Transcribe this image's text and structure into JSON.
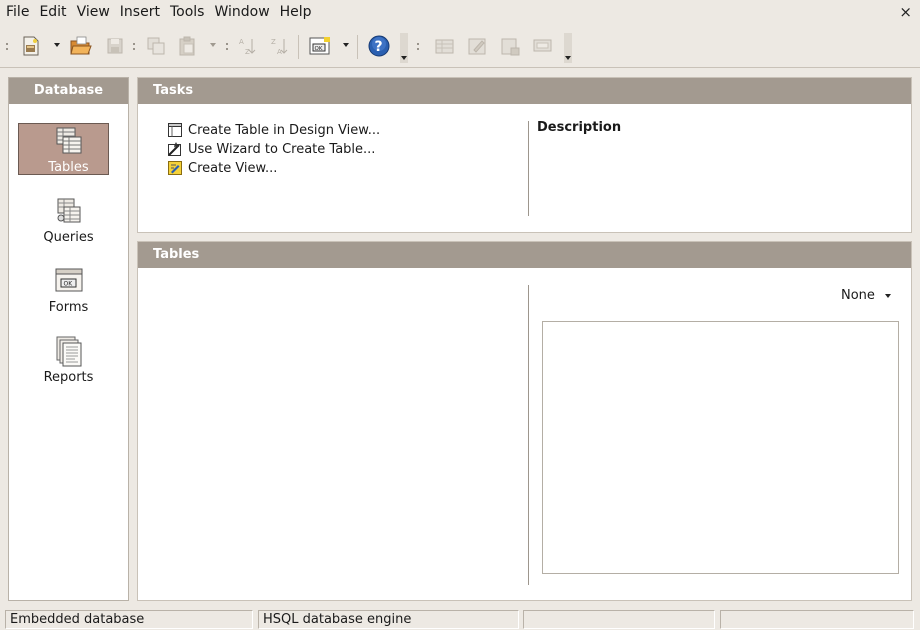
{
  "menubar": {
    "items": [
      "File",
      "Edit",
      "View",
      "Insert",
      "Tools",
      "Window",
      "Help"
    ],
    "close_glyph": "×"
  },
  "toolbar": {
    "icons": [
      "new-icon",
      "open-icon",
      "save-icon",
      "copy-icon",
      "paste-icon",
      "sort-ascending-icon",
      "sort-descending-icon",
      "form-design-icon",
      "help-icon",
      "table-icon",
      "edit-icon",
      "delete-icon",
      "rename-icon"
    ]
  },
  "sidebar": {
    "title": "Database",
    "items": [
      {
        "label": "Tables",
        "icon": "tables-icon",
        "selected": true
      },
      {
        "label": "Queries",
        "icon": "queries-icon",
        "selected": false
      },
      {
        "label": "Forms",
        "icon": "forms-icon",
        "selected": false
      },
      {
        "label": "Reports",
        "icon": "reports-icon",
        "selected": false
      }
    ]
  },
  "tasks": {
    "title": "Tasks",
    "items": [
      {
        "label": "Create Table in Design View...",
        "icon": "table-design-icon"
      },
      {
        "label": "Use Wizard to Create Table...",
        "icon": "wizard-icon"
      },
      {
        "label": "Create View...",
        "icon": "create-view-icon"
      }
    ],
    "description_title": "Description"
  },
  "tables": {
    "title": "Tables",
    "preview_option": "None"
  },
  "statusbar": {
    "cells": [
      "Embedded database",
      "HSQL database engine",
      "",
      ""
    ]
  },
  "colors": {
    "header_bg": "#a39a90",
    "selected_bg": "#b99a8e",
    "window_bg": "#ede9e3"
  }
}
